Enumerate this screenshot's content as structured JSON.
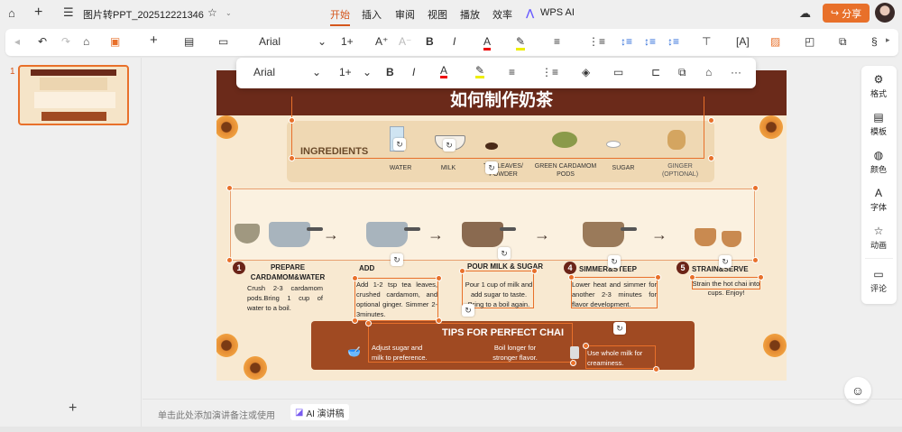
{
  "titlebar": {
    "doc_title": "图片转PPT_202512221346",
    "tabs": [
      "开始",
      "插入",
      "审阅",
      "视图",
      "播放",
      "效率"
    ],
    "active_tab": "开始",
    "wps_ai": "WPS AI",
    "share": "分享",
    "accent": "#e8702a"
  },
  "toolbar": {
    "font": "Arial",
    "size": "1+",
    "bold": "B",
    "italic": "I"
  },
  "floating_toolbar": {
    "font": "Arial",
    "size": "1+",
    "bold": "B",
    "italic": "I",
    "more": "···"
  },
  "thumbs": {
    "items": [
      {
        "number": "1"
      }
    ],
    "add": "+"
  },
  "slide": {
    "title": "如何制作奶茶",
    "ingredients_heading": "INGREDIENTS",
    "ingredients": [
      "WATER",
      "MILK",
      "TEA LEAVES/ POWDER",
      "GREEN CARDAMOM PODS",
      "SUGAR",
      "GINGER (OPTIONAL)"
    ],
    "steps": [
      {
        "num": "1",
        "title": "PREPARE CARDAMOM&WATER",
        "body": "Crush 2-3 cardamom pods.Bring 1 cup of water to a boil."
      },
      {
        "num": "",
        "title": "ADD",
        "body": "Add 1-2 tsp tea leaves, crushed cardamom, and optional ginger. Simmer 2-3minutes."
      },
      {
        "num": "",
        "title": "POUR MILK & SUGAR",
        "body": "Pour 1 cup of milk and add sugar to taste. Bring to a boil again."
      },
      {
        "num": "4",
        "title": "SIMMER&STEEP",
        "body": "Lower heat and simmer for another 2-3 minutes for flavor development."
      },
      {
        "num": "5",
        "title": "STRAIN&SERVE",
        "body": "Strain the hot chai into cups. Enjoy!"
      }
    ],
    "tips_title": "TIPS FOR PERFECT CHAI",
    "tips": [
      "Adjust sugar and milk to preference.",
      "Boil longer for stronger flavor.",
      "Use whole milk for creaminess."
    ]
  },
  "notes": {
    "placeholder": "单击此处添加演讲备注或使用",
    "ai_button": "AI 演讲稿"
  },
  "right_panel": [
    {
      "icon": "gear-icon",
      "label": "格式"
    },
    {
      "icon": "template-icon",
      "label": "模板"
    },
    {
      "icon": "palette-icon",
      "label": "颜色"
    },
    {
      "icon": "font-icon",
      "label": "字体"
    },
    {
      "icon": "star-icon",
      "label": "动画"
    },
    {
      "icon": "comment-icon",
      "label": "评论"
    }
  ]
}
